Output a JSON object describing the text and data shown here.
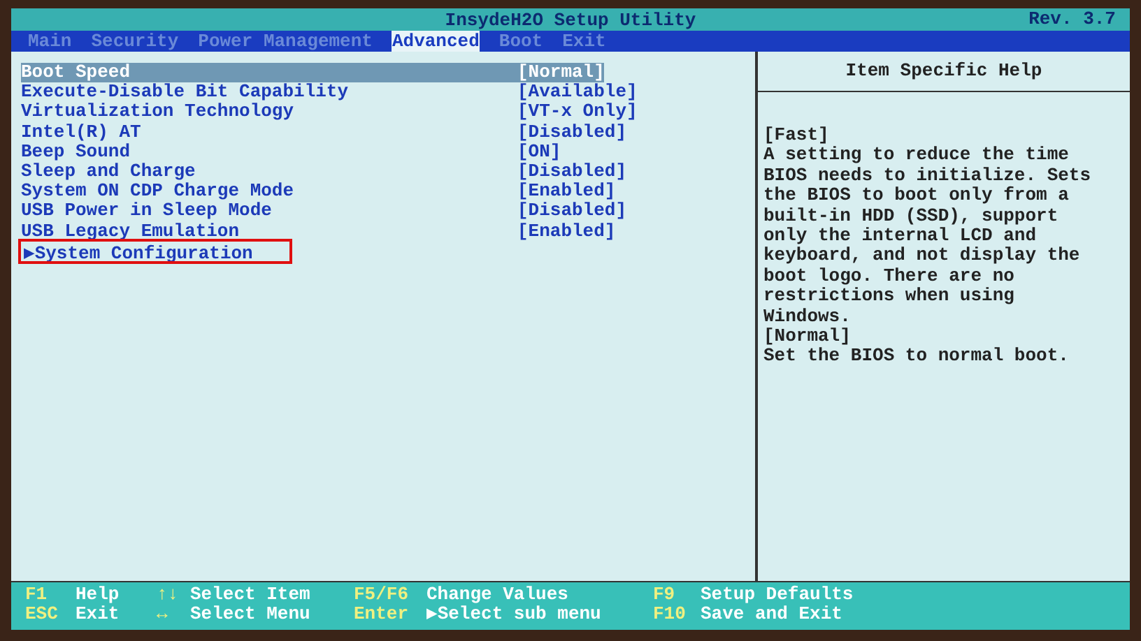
{
  "window": {
    "title": "InsydeH2O Setup Utility",
    "revision": "Rev. 3.7"
  },
  "tabs": [
    {
      "label": "Main",
      "selected": false
    },
    {
      "label": "Security",
      "selected": false
    },
    {
      "label": "Power Management",
      "selected": false
    },
    {
      "label": "Advanced",
      "selected": true
    },
    {
      "label": "Boot",
      "selected": false
    },
    {
      "label": "Exit",
      "selected": false
    }
  ],
  "items": [
    {
      "kind": "setting",
      "label": "Boot Speed",
      "value": "[Normal]",
      "selected": true,
      "highlighted": false
    },
    {
      "kind": "setting",
      "label": "Execute-Disable Bit Capability",
      "value": "[Available]",
      "selected": false,
      "highlighted": false
    },
    {
      "kind": "setting",
      "label": "Virtualization Technology",
      "value": "[VT-x Only]",
      "selected": false,
      "highlighted": false
    },
    {
      "kind": "setting",
      "label": "Intel(R) AT",
      "value": "[Disabled]",
      "selected": false,
      "highlighted": false
    },
    {
      "kind": "setting",
      "label": "Beep Sound",
      "value": "[ON]",
      "selected": false,
      "highlighted": false
    },
    {
      "kind": "setting",
      "label": "Sleep and Charge",
      "value": "[Disabled]",
      "selected": false,
      "highlighted": false
    },
    {
      "kind": "setting",
      "label": "System ON CDP Charge Mode",
      "value": "[Enabled]",
      "selected": false,
      "highlighted": false
    },
    {
      "kind": "setting",
      "label": "USB Power in Sleep Mode",
      "value": "[Disabled]",
      "selected": false,
      "highlighted": false
    },
    {
      "kind": "setting",
      "label": "USB Legacy Emulation",
      "value": "[Enabled]",
      "selected": false,
      "highlighted": false
    },
    {
      "kind": "submenu",
      "label": "▶System Configuration",
      "selected": false,
      "highlighted": true
    }
  ],
  "help": {
    "title": "Item Specific Help",
    "lines": [
      "[Fast]",
      "A setting to reduce the time",
      "BIOS needs to initialize. Sets",
      "the BIOS to boot only from a",
      "built-in HDD (SSD), support",
      "only the internal LCD and",
      "keyboard, and not display the",
      "boot logo. There are no",
      "restrictions when using",
      "Windows.",
      "[Normal]",
      "Set the BIOS to normal boot."
    ]
  },
  "footer": [
    {
      "key": "F1",
      "label": "Help"
    },
    {
      "key": "ESC",
      "label": "Exit"
    },
    {
      "key": "↑↓",
      "label": "Select Item"
    },
    {
      "key": "↔",
      "label": "Select Menu"
    },
    {
      "key": "F5/F6",
      "label": "Change Values"
    },
    {
      "key": "Enter",
      "label": "▶Select sub menu"
    },
    {
      "key": "F9",
      "label": "Setup Defaults"
    },
    {
      "key": "F10",
      "label": "Save and Exit"
    }
  ]
}
